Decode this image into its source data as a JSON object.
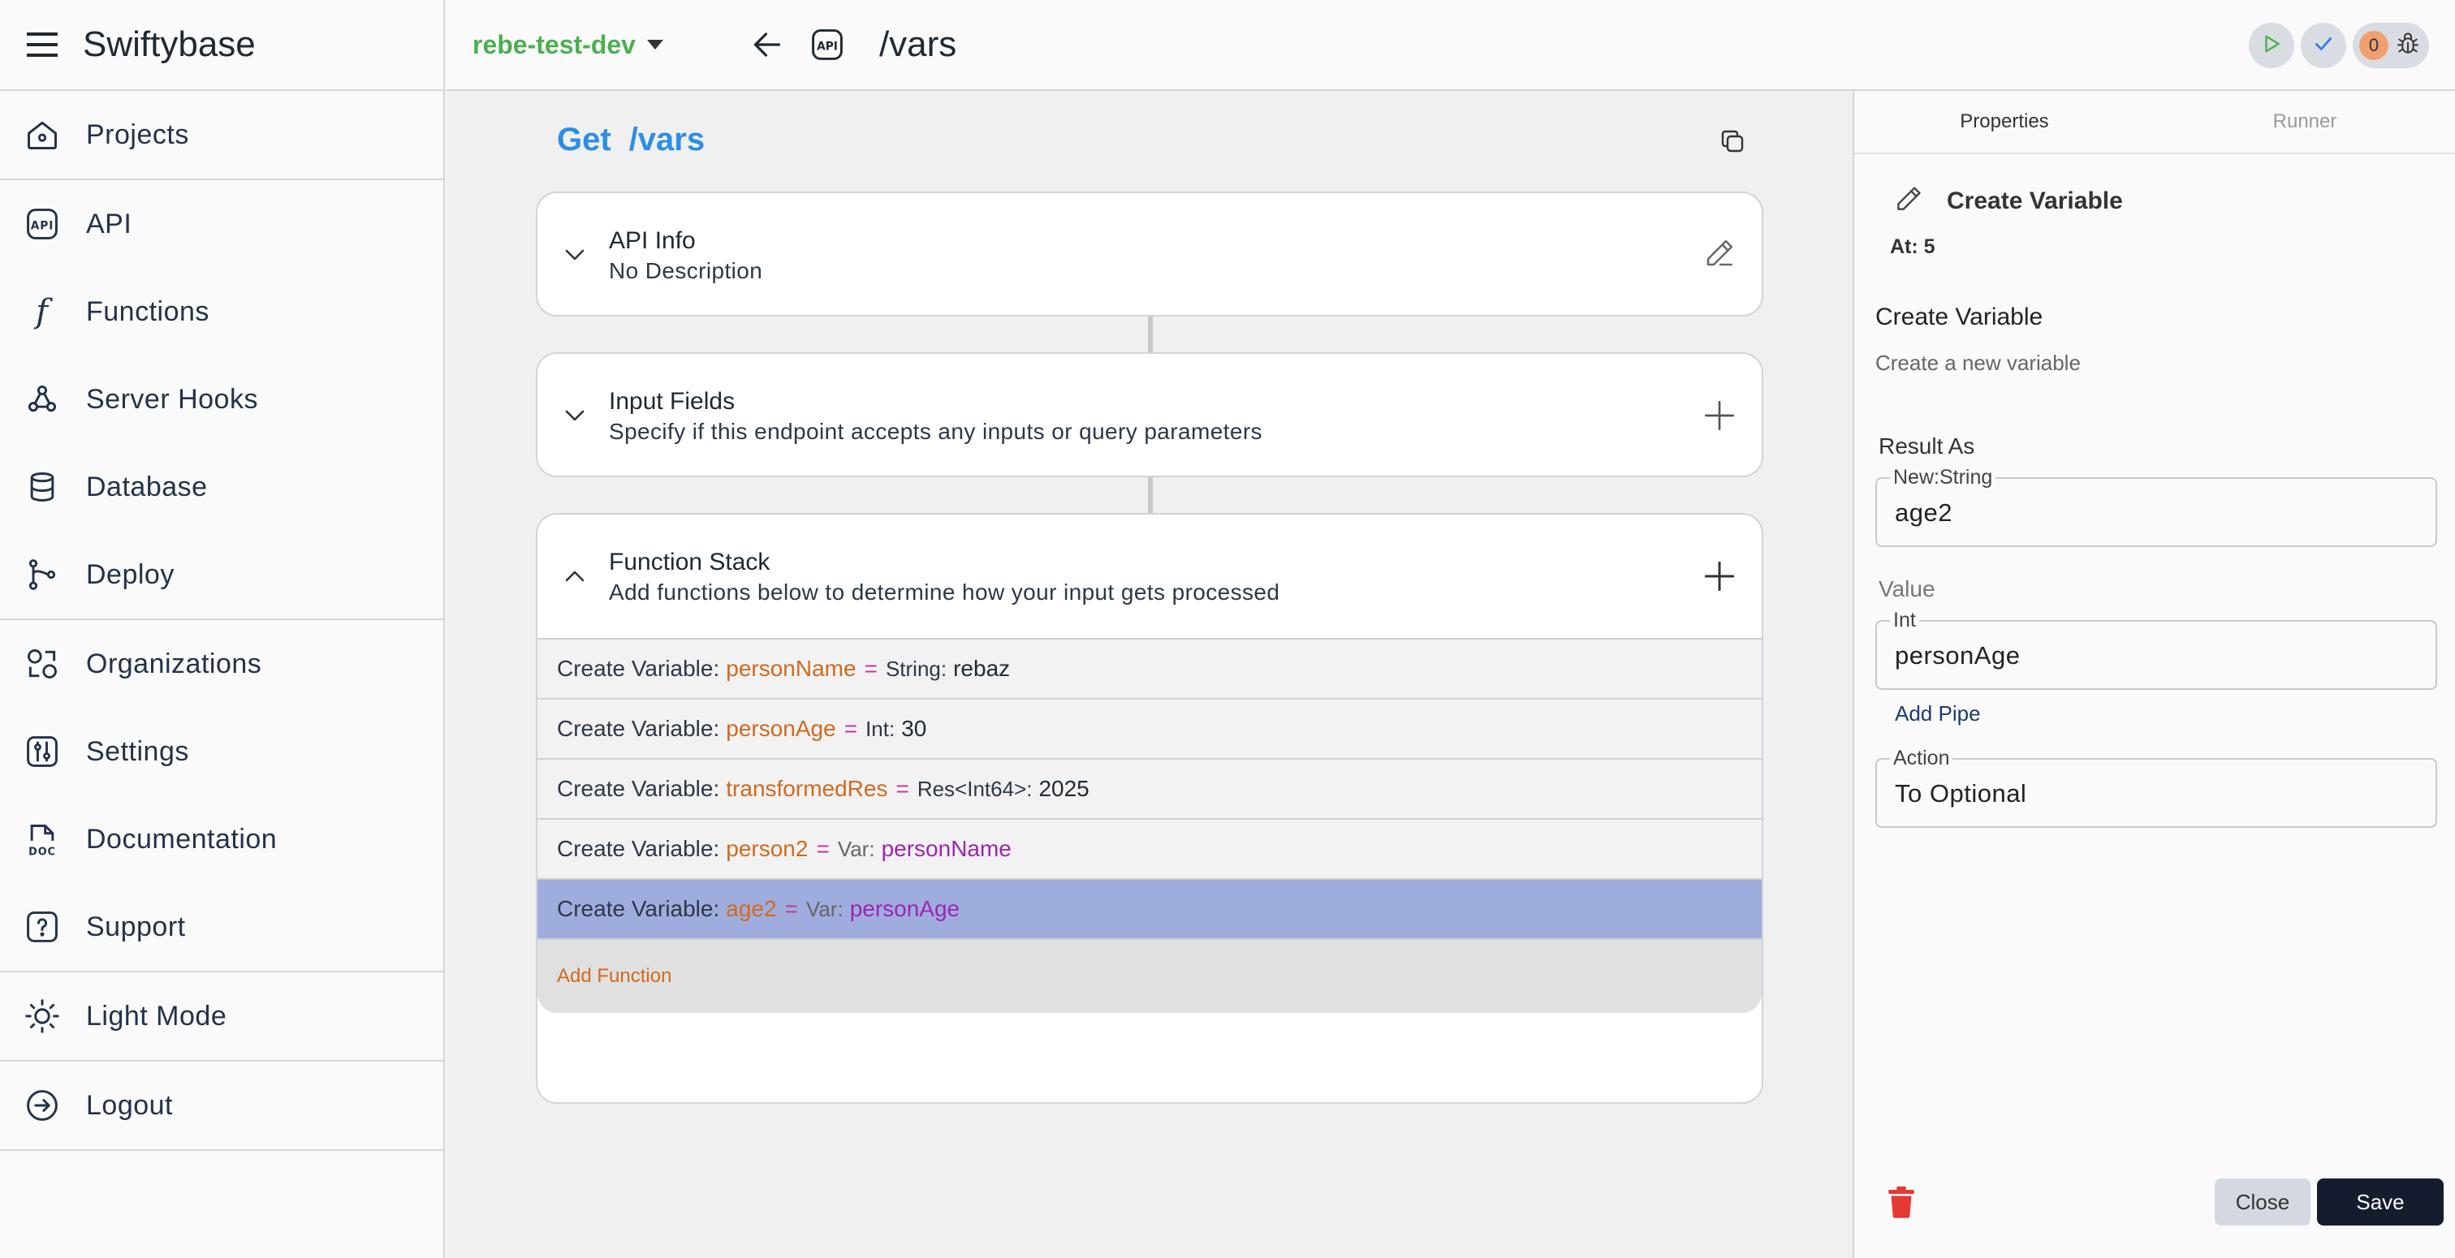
{
  "app": {
    "title": "Swiftybase"
  },
  "sidebar": {
    "groups": [
      [
        {
          "label": "Projects",
          "icon": "house-icon"
        }
      ],
      [
        {
          "label": "API",
          "icon": "api-icon"
        },
        {
          "label": "Functions",
          "icon": "function-icon"
        },
        {
          "label": "Server Hooks",
          "icon": "webhook-icon"
        },
        {
          "label": "Database",
          "icon": "database-icon"
        },
        {
          "label": "Deploy",
          "icon": "git-branch-icon"
        }
      ],
      [
        {
          "label": "Organizations",
          "icon": "shapes-icon"
        },
        {
          "label": "Settings",
          "icon": "settings-icon"
        },
        {
          "label": "Documentation",
          "icon": "doc-icon"
        },
        {
          "label": "Support",
          "icon": "help-icon"
        }
      ],
      [
        {
          "label": "Light Mode",
          "icon": "sun-icon"
        }
      ],
      [
        {
          "label": "Logout",
          "icon": "logout-icon"
        }
      ]
    ]
  },
  "topbar": {
    "project": "rebe-test-dev",
    "route": "/vars",
    "issue_count": "0",
    "colors": {
      "project": "#4caf50",
      "run": "#4caf50",
      "check": "#2b7ae6"
    }
  },
  "endpoint": {
    "method": "Get",
    "path": "/vars",
    "api_info": {
      "title": "API Info",
      "description": "No Description"
    },
    "input_fields": {
      "title": "Input Fields",
      "description": "Specify if this endpoint accepts any inputs or query parameters"
    },
    "function_stack": {
      "title": "Function Stack",
      "description": "Add functions below to determine how your input gets processed",
      "add_label": "Add Function",
      "rows": [
        {
          "prefix": "Create Variable:",
          "name": "personName",
          "eq": "=",
          "type": "String:",
          "value": "rebaz",
          "value_is_var": false,
          "selected": false
        },
        {
          "prefix": "Create Variable:",
          "name": "personAge",
          "eq": "=",
          "type": "Int:",
          "value": "30",
          "value_is_var": false,
          "selected": false
        },
        {
          "prefix": "Create Variable:",
          "name": "transformedRes",
          "eq": "=",
          "type": "Res<Int64>:",
          "value": "2025",
          "value_is_var": false,
          "selected": false
        },
        {
          "prefix": "Create Variable:",
          "name": "person2",
          "eq": "=",
          "type": "Var:",
          "value": "personName",
          "value_is_var": true,
          "selected": false
        },
        {
          "prefix": "Create Variable:",
          "name": "age2",
          "eq": "=",
          "type": "Var:",
          "value": "personAge",
          "value_is_var": true,
          "selected": true
        }
      ]
    }
  },
  "panel": {
    "tabs": [
      "Properties",
      "Runner"
    ],
    "active_tab": "Properties",
    "header_title": "Create Variable",
    "at_label": "At: 5",
    "name": "Create Variable",
    "description": "Create a new variable",
    "result_label": "Result As",
    "result_legend": "New:String",
    "result_value": "age2",
    "value_label": "Value",
    "value_legend": "Int",
    "value_value": "personAge",
    "add_pipe": "Add Pipe",
    "action_legend": "Action",
    "action_value": "To Optional",
    "close_label": "Close",
    "save_label": "Save"
  }
}
